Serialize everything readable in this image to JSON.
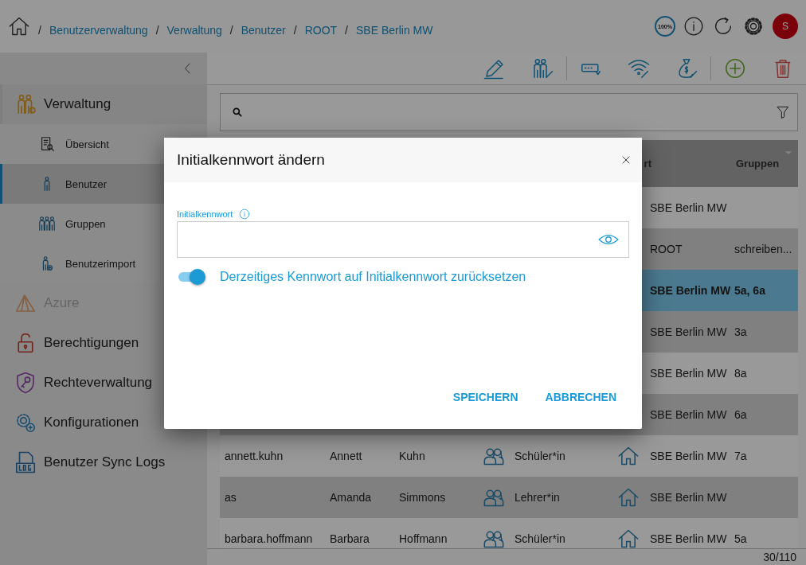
{
  "breadcrumbs": [
    {
      "separator": "/",
      "label": "Benutzerverwaltung"
    },
    {
      "separator": "/",
      "label": "Verwaltung"
    },
    {
      "separator": "/",
      "label": "Benutzer"
    },
    {
      "separator": "/",
      "label": "ROOT"
    },
    {
      "separator": "/",
      "label": "SBE Berlin MW"
    }
  ],
  "header": {
    "zoom": "100%",
    "avatar": "S"
  },
  "sidebar": {
    "items": [
      {
        "label": "Verwaltung",
        "disabled": false,
        "expanded": true,
        "children": [
          {
            "label": "Übersicht",
            "selected": false
          },
          {
            "label": "Benutzer",
            "selected": true
          },
          {
            "label": "Gruppen",
            "selected": false
          },
          {
            "label": "Benutzerimport",
            "selected": false
          }
        ]
      },
      {
        "label": "Azure",
        "disabled": true
      },
      {
        "label": "Berechtigungen",
        "disabled": false
      },
      {
        "label": "Rechteverwaltung",
        "disabled": false
      },
      {
        "label": "Konfigurationen",
        "disabled": false
      },
      {
        "label": "Benutzer Sync Logs",
        "disabled": false
      }
    ]
  },
  "table": {
    "columns": [
      {
        "label": "rt"
      },
      {
        "label": "Gruppen"
      }
    ],
    "rows": [
      {
        "location": "SBE Berlin MW",
        "selected": false
      },
      {
        "location": "ROOT",
        "groups": "schreiben...",
        "selected": false
      },
      {
        "location": "SBE Berlin MW",
        "groups": "5a, 6a",
        "selected": true
      },
      {
        "location": "SBE Berlin MW",
        "groups": "3a",
        "selected": false
      },
      {
        "location": "SBE Berlin MW",
        "groups": "8a",
        "selected": false
      },
      {
        "location": "SBE Berlin MW",
        "groups": "6a",
        "selected": false
      },
      {
        "username": "annett.kuhn",
        "first_name": "Annett",
        "last_name": "Kuhn",
        "role": "Schüler*in",
        "location": "SBE Berlin MW",
        "groups": "7a",
        "selected": false
      },
      {
        "username": "as",
        "first_name": "Amanda",
        "last_name": "Simmons",
        "role": "Lehrer*in",
        "location": "SBE Berlin MW",
        "selected": false
      },
      {
        "username": "barbara.hoffmann",
        "first_name": "Barbara",
        "last_name": "Hoffmann",
        "role": "Schüler*in",
        "location": "SBE Berlin MW",
        "groups": "5a",
        "selected": false
      }
    ]
  },
  "pagination": "30/110",
  "dialog": {
    "title": "Initialkennwort ändern",
    "field_label": "Initialkennwort",
    "reset_toggle": {
      "label": "Derzeitiges Kennwort auf Initialkennwort zurücksetzen",
      "on": true
    },
    "buttons": [
      {
        "label": "SPEICHERN"
      },
      {
        "label": "ABBRECHEN"
      }
    ]
  }
}
